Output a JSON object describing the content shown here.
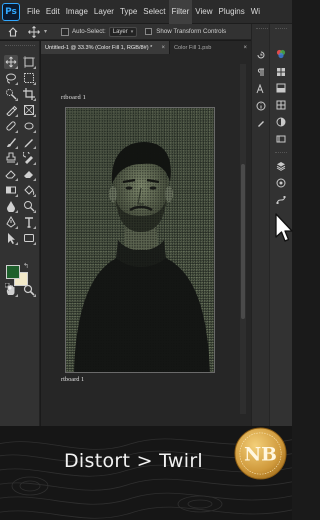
{
  "app": {
    "logo_text": "Ps",
    "menu": [
      "File",
      "Edit",
      "Image",
      "Layer",
      "Type",
      "Select",
      "Filter",
      "View",
      "Plugins",
      "Wi"
    ],
    "active_menu": "Filter"
  },
  "options_bar": {
    "auto_select_label": "Auto-Select:",
    "auto_select_value": "Layer",
    "show_transform_label": "Show Transform Controls"
  },
  "tabs": [
    {
      "label": "Untitled-1 @ 33.3% (Color Fill 1, RGB/8#) *",
      "close": "×",
      "active": true
    },
    {
      "label": "Color Fill 1.psb",
      "close": "×",
      "active": false
    }
  ],
  "canvas": {
    "artboard_label": "rtboard 1",
    "artboard_bottom_label": "rtboard 1"
  },
  "colors": {
    "foreground": "#1e5f2c",
    "background": "#f2e9c9",
    "accent": "#31a8ff",
    "badge_gold": "#d9a441"
  },
  "tools": [
    "move-tool",
    "artboard-tool",
    "lasso-tool",
    "marquee-tool",
    "quick-select-tool",
    "crop-tool",
    "eyedropper-tool",
    "frame-tool",
    "healing-brush-tool",
    "patch-tool",
    "brush-tool",
    "pencil-tool",
    "clone-stamp-tool",
    "history-brush-tool",
    "eraser-tool",
    "background-eraser-tool",
    "gradient-tool",
    "paint-bucket-tool",
    "blur-tool",
    "dodge-tool",
    "pen-tool",
    "type-tool",
    "path-select-tool",
    "shape-tool",
    "hand-tool",
    "zoom-tool"
  ],
  "caption": {
    "text": "Distort > Twirl"
  },
  "badge": {
    "monogram": "NB"
  }
}
